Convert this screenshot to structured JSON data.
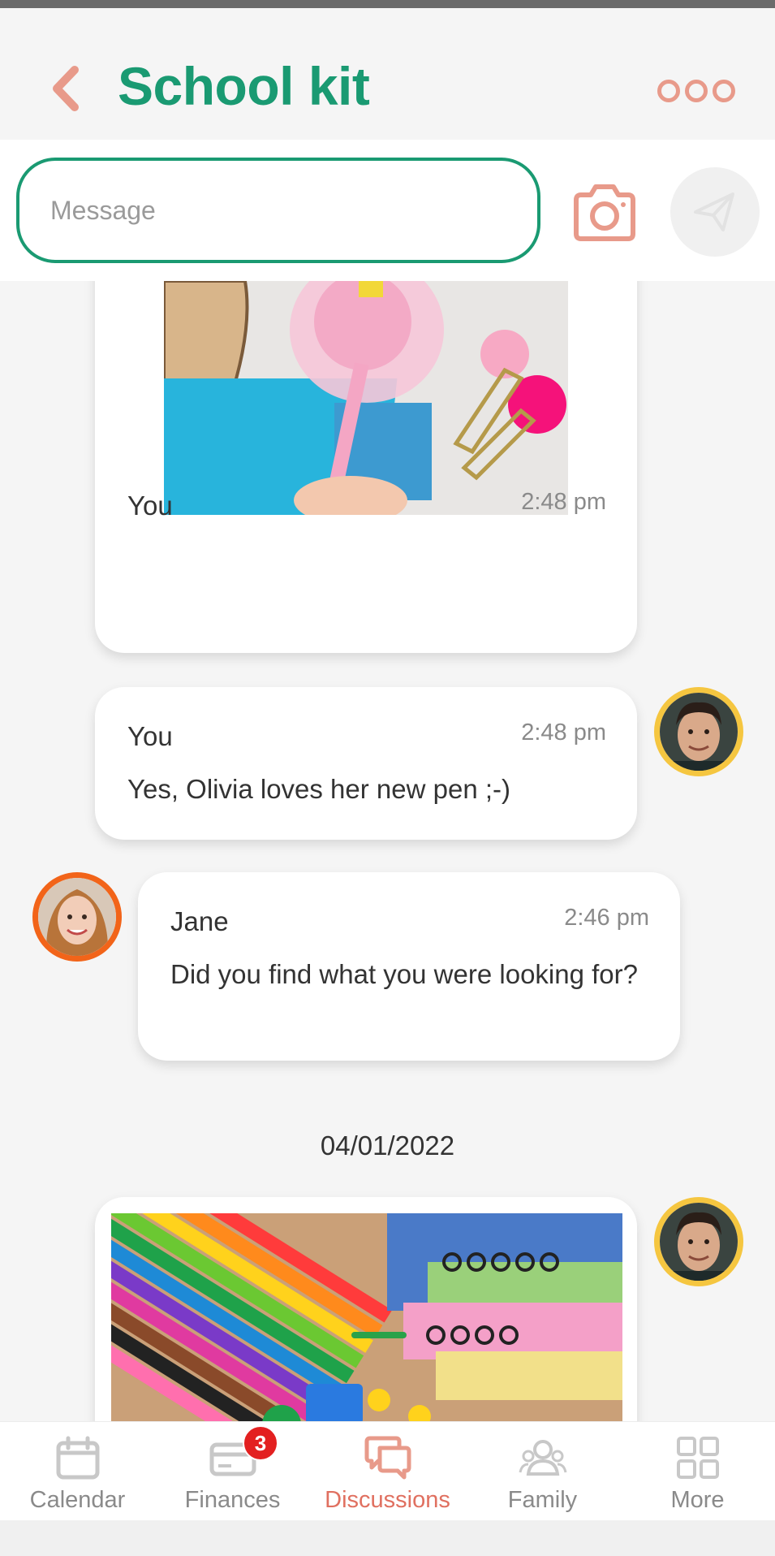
{
  "header": {
    "title": "School kit"
  },
  "composer": {
    "placeholder": "Message"
  },
  "messages": [
    {
      "sender": "You",
      "time": "2:48 pm",
      "type": "image",
      "image": "pen-photo"
    },
    {
      "sender": "You",
      "time": "2:48 pm",
      "text": "Yes, Olivia loves her new pen ;-)"
    },
    {
      "sender": "Jane",
      "time": "2:46 pm",
      "text": "Did you find what you were looking for?"
    }
  ],
  "date_separator": "04/01/2022",
  "bottom_nav": {
    "items": [
      {
        "label": "Calendar",
        "icon": "calendar-icon"
      },
      {
        "label": "Finances",
        "icon": "card-icon",
        "badge": "3"
      },
      {
        "label": "Discussions",
        "icon": "chat-icon",
        "active": true
      },
      {
        "label": "Family",
        "icon": "people-icon"
      },
      {
        "label": "More",
        "icon": "grid-icon"
      }
    ]
  },
  "colors": {
    "brand_green": "#1a9a72",
    "accent_coral": "#e07060",
    "badge_red": "#e32020",
    "avatar_ring_you": "#f5c640",
    "avatar_ring_jane": "#f26419"
  }
}
